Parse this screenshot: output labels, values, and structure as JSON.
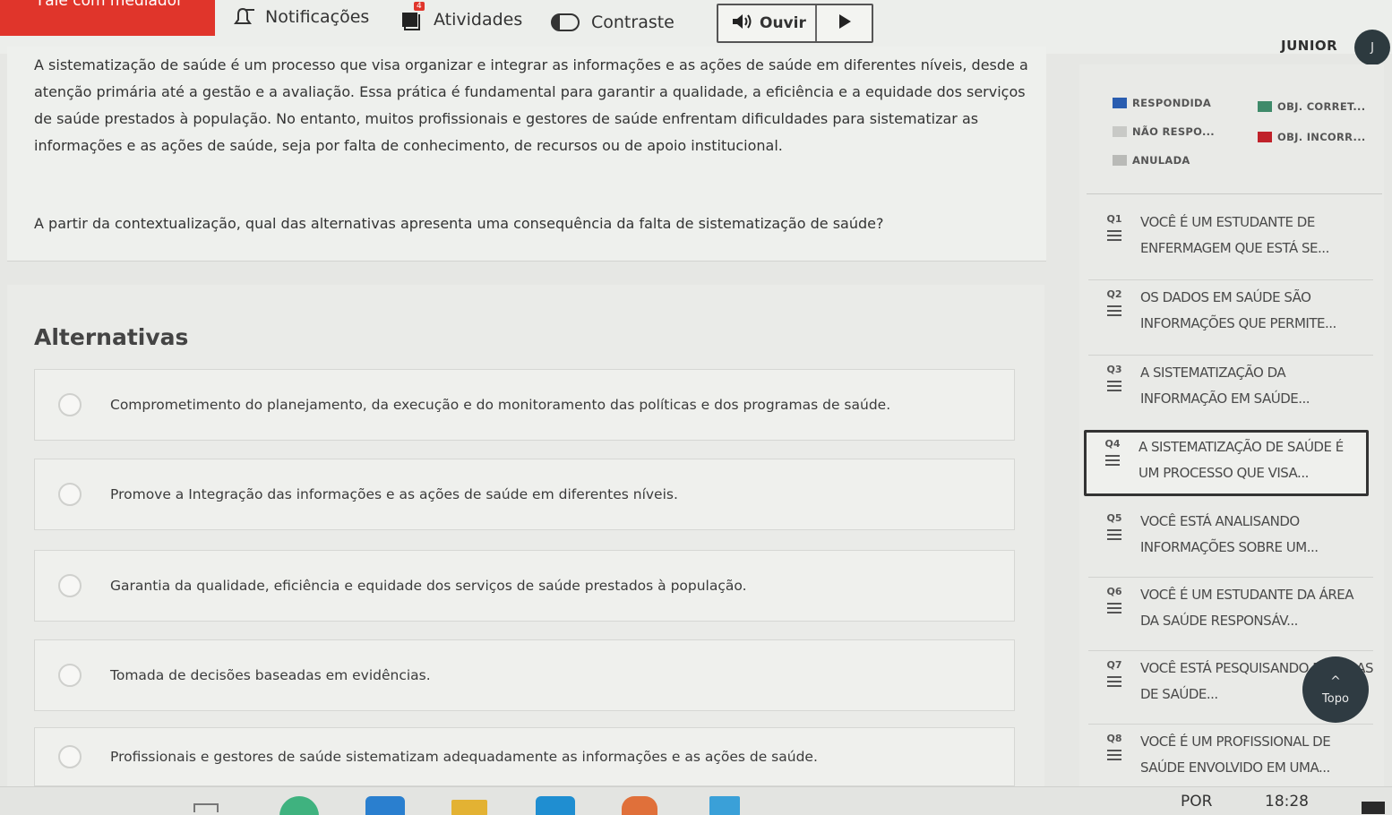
{
  "toolbar": {
    "talk_label": "Fale com mediador",
    "notifications_label": "Notificações",
    "activities_label": "Atividades",
    "activities_badge": "4",
    "contrast_label": "Contraste",
    "listen_label": "Ouvir"
  },
  "user": {
    "name": "JUNIOR",
    "initial": "J"
  },
  "question": {
    "statement": "A sistematização de saúde é um processo que visa organizar e integrar as informações e as ações de saúde em diferentes níveis, desde a atenção primária até a gestão e a avaliação. Essa prática é fundamental para garantir a qualidade, a eficiência e a equidade dos serviços de saúde prestados à população. No entanto, muitos profissionais e gestores de saúde enfrentam dificuldades para sistematizar as informações e as ações de saúde, seja por falta de conhecimento, de recursos ou de apoio institucional.",
    "prompt": "A partir da contextualização, qual das alternativas apresenta uma consequência da falta de sistematização de saúde?"
  },
  "alternatives": {
    "title": "Alternativas",
    "options": [
      "Comprometimento do planejamento, da execução e do monitoramento das políticas e dos programas de saúde.",
      "Promove a Integração das informações e as ações de saúde em diferentes níveis.",
      "Garantia da qualidade, eficiência e equidade dos serviços de saúde prestados à população.",
      "Tomada de decisões baseadas em evidências.",
      "Profissionais e gestores de saúde sistematizam adequadamente as informações e as ações de saúde."
    ]
  },
  "legend": {
    "answered": "RESPONDIDA",
    "correct": "OBJ. CORRET...",
    "unanswered": "NÃO RESPO...",
    "incorrect": "OBJ. INCORR...",
    "annulled": "ANULADA",
    "colors": {
      "answered": "#2a5db0",
      "correct": "#3f8a6a",
      "unanswered": "#c8c9c6",
      "incorrect": "#c0222a",
      "annulled": "#b9bab7"
    }
  },
  "questions": [
    {
      "num": "Q1",
      "text": "Você é um estudante de enfermagem que está se..."
    },
    {
      "num": "Q2",
      "text": "Os dados em saúde são informações que permite..."
    },
    {
      "num": "Q3",
      "text": "A sistematização da informação em saúde..."
    },
    {
      "num": "Q4",
      "text": "A sistematização de saúde é um processo que visa..."
    },
    {
      "num": "Q5",
      "text": "Você está analisando informações sobre um..."
    },
    {
      "num": "Q6",
      "text": "Você é um estudante da área da saúde responsáv..."
    },
    {
      "num": "Q7",
      "text": "Você está pesquisando práticas de saúde..."
    },
    {
      "num": "Q8",
      "text": "Você é um profissional de saúde envolvido em uma..."
    }
  ],
  "scroll_top_label": "Topo",
  "taskbar": {
    "lang": "POR",
    "time": "18:28"
  }
}
